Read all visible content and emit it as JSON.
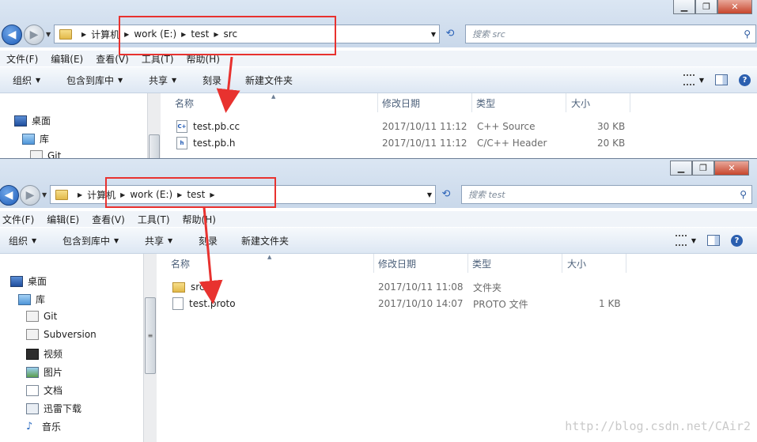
{
  "top_window": {
    "path": [
      "计算机",
      "work (E:)",
      "test",
      "src"
    ],
    "search_placeholder": "搜索 src",
    "menu": [
      "文件(F)",
      "编辑(E)",
      "查看(V)",
      "工具(T)",
      "帮助(H)"
    ],
    "toolbar": [
      "组织",
      "包含到库中",
      "共享",
      "刻录",
      "新建文件夹"
    ],
    "columns": [
      "名称",
      "修改日期",
      "类型",
      "大小"
    ],
    "nav": [
      {
        "label": "桌面",
        "icon": "desktop-icon"
      },
      {
        "label": "库",
        "icon": "library-icon"
      },
      {
        "label": "Git",
        "icon": "git-icon"
      }
    ],
    "files": [
      {
        "name": "test.pb.cc",
        "date": "2017/10/11 11:12",
        "type": "C++ Source",
        "size": "30 KB",
        "icon": "cpp-file-icon"
      },
      {
        "name": "test.pb.h",
        "date": "2017/10/11 11:12",
        "type": "C/C++ Header",
        "size": "20 KB",
        "icon": "header-file-icon"
      }
    ]
  },
  "bottom_window": {
    "path": [
      "计算机",
      "work (E:)",
      "test"
    ],
    "search_placeholder": "搜索 test",
    "menu": [
      "文件(F)",
      "编辑(E)",
      "查看(V)",
      "工具(T)",
      "帮助(H)"
    ],
    "toolbar": [
      "组织",
      "包含到库中",
      "共享",
      "刻录",
      "新建文件夹"
    ],
    "columns": [
      "名称",
      "修改日期",
      "类型",
      "大小"
    ],
    "nav": [
      {
        "label": "桌面",
        "icon": "desktop-icon"
      },
      {
        "label": "库",
        "icon": "library-icon"
      },
      {
        "label": "Git",
        "icon": "git-icon"
      },
      {
        "label": "Subversion",
        "icon": "subversion-icon"
      },
      {
        "label": "视频",
        "icon": "video-icon"
      },
      {
        "label": "图片",
        "icon": "picture-icon"
      },
      {
        "label": "文档",
        "icon": "document-icon"
      },
      {
        "label": "迅雷下载",
        "icon": "download-icon"
      },
      {
        "label": "音乐",
        "icon": "music-icon"
      }
    ],
    "files": [
      {
        "name": "src",
        "date": "2017/10/11 11:08",
        "type": "文件夹",
        "size": "",
        "icon": "folder-icon"
      },
      {
        "name": "test.proto",
        "date": "2017/10/10 14:07",
        "type": "PROTO 文件",
        "size": "1 KB",
        "icon": "proto-file-icon"
      }
    ]
  },
  "watermark": "http://blog.csdn.net/CAir2",
  "colors": {
    "annotation": "#e8322f",
    "accent": "#2b5faf"
  }
}
